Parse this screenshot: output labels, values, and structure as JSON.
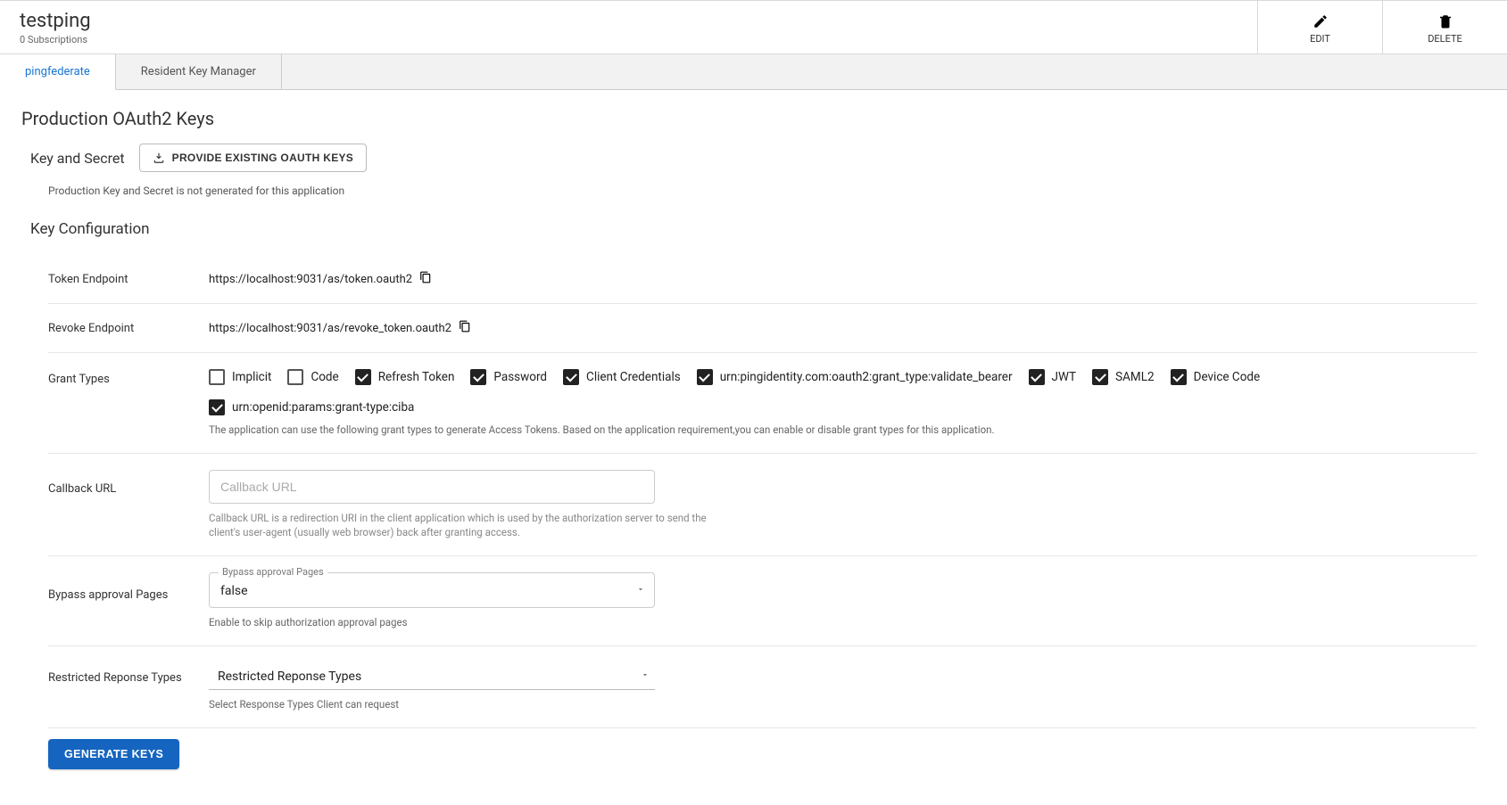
{
  "header": {
    "title": "testping",
    "subtitle": "0 Subscriptions",
    "actions": {
      "edit": "EDIT",
      "delete": "DELETE"
    }
  },
  "tabs": [
    {
      "label": "pingfederate",
      "active": true
    },
    {
      "label": "Resident Key Manager",
      "active": false
    }
  ],
  "section": {
    "title": "Production OAuth2 Keys",
    "keySecret": {
      "title": "Key and Secret",
      "provideBtn": "PROVIDE EXISTING OAUTH KEYS",
      "info": "Production Key and Secret is not generated for this application"
    },
    "config": {
      "title": "Key Configuration",
      "tokenEndpoint": {
        "label": "Token Endpoint",
        "value": "https://localhost:9031/as/token.oauth2"
      },
      "revokeEndpoint": {
        "label": "Revoke Endpoint",
        "value": "https://localhost:9031/as/revoke_token.oauth2"
      },
      "grantTypes": {
        "label": "Grant Types",
        "helper": "The application can use the following grant types to generate Access Tokens. Based on the application requirement,you can enable or disable grant types for this application.",
        "items": [
          {
            "label": "Implicit",
            "checked": false
          },
          {
            "label": "Code",
            "checked": false
          },
          {
            "label": "Refresh Token",
            "checked": true
          },
          {
            "label": "Password",
            "checked": true
          },
          {
            "label": "Client Credentials",
            "checked": true
          },
          {
            "label": "urn:pingidentity.com:oauth2:grant_type:validate_bearer",
            "checked": true
          },
          {
            "label": "JWT",
            "checked": true
          },
          {
            "label": "SAML2",
            "checked": true
          },
          {
            "label": "Device Code",
            "checked": true
          },
          {
            "label": "urn:openid:params:grant-type:ciba",
            "checked": true
          }
        ]
      },
      "callback": {
        "label": "Callback URL",
        "placeholder": "Callback URL",
        "helper": "Callback URL is a redirection URI in the client application which is used by the authorization server to send the client's user-agent (usually web browser) back after granting access."
      },
      "bypass": {
        "label": "Bypass approval Pages",
        "floatLabel": "Bypass approval Pages",
        "value": "false",
        "helper": "Enable to skip authorization approval pages"
      },
      "restricted": {
        "label": "Restricted Reponse Types",
        "value": "Restricted Reponse Types",
        "helper": "Select Response Types Client can request"
      },
      "generateBtn": "GENERATE KEYS"
    }
  }
}
